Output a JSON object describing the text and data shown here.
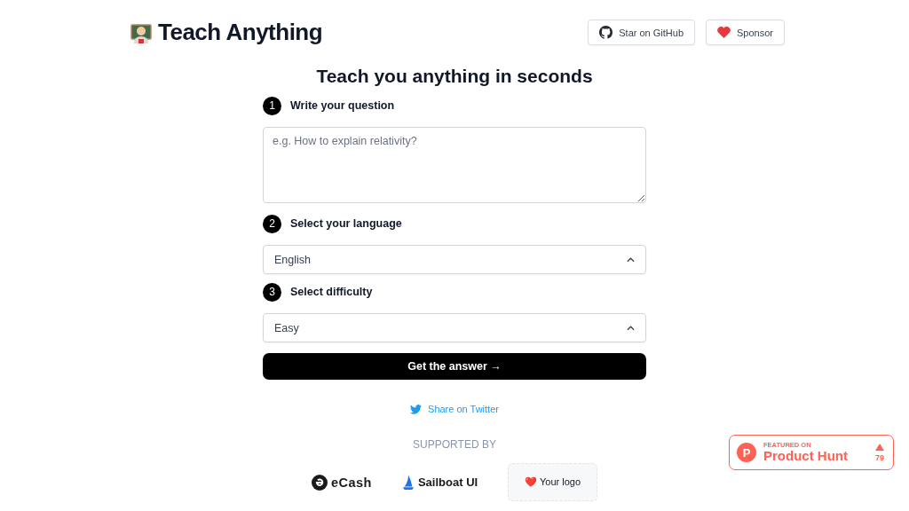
{
  "header": {
    "brand": "Teach Anything",
    "buttons": [
      {
        "kind": "github",
        "label": "Star on GitHub"
      },
      {
        "kind": "sponsor",
        "label": "Sponsor"
      }
    ]
  },
  "title": "Teach you anything in seconds",
  "steps": [
    {
      "number": "1",
      "label": "Write your question",
      "kind": "textarea",
      "placeholder": "e.g. How to explain relativity?"
    },
    {
      "number": "2",
      "label": "Select your language",
      "kind": "select",
      "value": "English"
    },
    {
      "number": "3",
      "label": "Select difficulty",
      "kind": "select",
      "value": "Easy"
    }
  ],
  "submit": "Get the answer →",
  "share": "Share on Twitter",
  "supported_by": {
    "heading": "SUPPORTED BY",
    "sponsors": [
      {
        "kind": "ecash",
        "name": "eCash"
      },
      {
        "kind": "sailboat",
        "name": "Sailboat UI"
      },
      {
        "kind": "placeholder",
        "name": "❤️ Your logo"
      }
    ]
  },
  "product_hunt": {
    "logo_letter": "P",
    "caption": "FEATURED ON",
    "name": "Product Hunt",
    "votes": "79"
  }
}
